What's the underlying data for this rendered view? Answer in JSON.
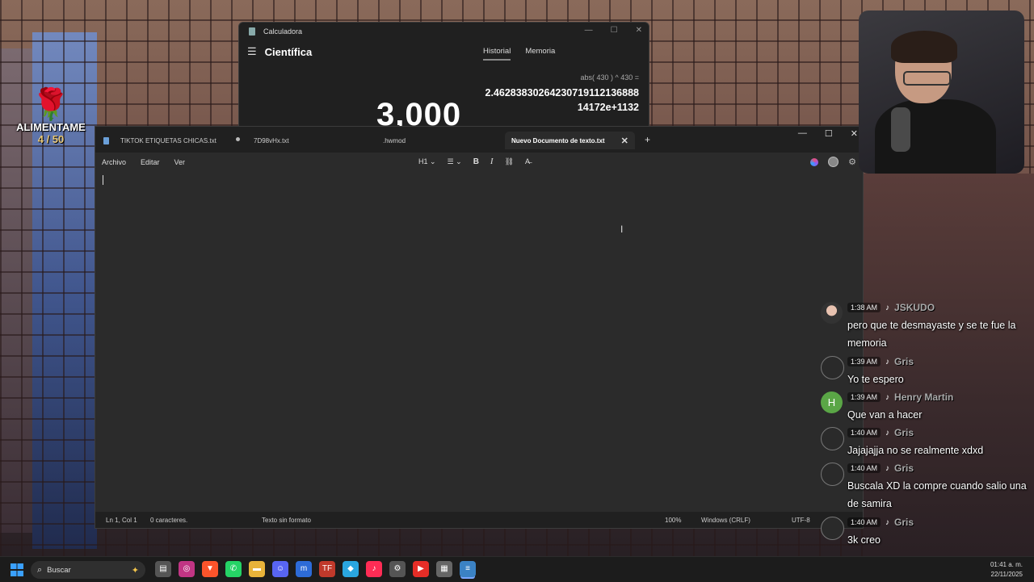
{
  "overlay": {
    "rose_glyph": "🌹",
    "title": "ALIMENTAME",
    "progress": "4 / 50"
  },
  "calculator": {
    "window_title": "Calculadora",
    "mode": "Científica",
    "tabs": [
      "Historial",
      "Memoria"
    ],
    "expression": "abs( 430 )   ^   430 =",
    "result_line1": "2.46283830264230719112136888",
    "result_line2": "14172e+1132",
    "display_value": "3,000",
    "window_buttons": [
      "—",
      "☐",
      "✕"
    ]
  },
  "notepad": {
    "tabs": [
      {
        "label": "TIKTOK ETIQUETAS CHICAS.txt",
        "modified": true
      },
      {
        "label": "7D98vHx.txt",
        "modified": false
      },
      {
        "label": ".hwmod",
        "modified": false
      },
      {
        "label": "Nuevo Documento de texto.txt",
        "active": true
      }
    ],
    "new_tab": "+",
    "close_tab": "✕",
    "window_buttons": [
      "—",
      "☐",
      "✕"
    ],
    "menu": [
      "Archivo",
      "Editar",
      "Ver"
    ],
    "format": {
      "heading": "H1",
      "list": "☰",
      "bold": "B",
      "italic": "I",
      "link": "⛓",
      "clear": "A̶"
    },
    "status": {
      "position": "Ln 1, Col 1",
      "chars": "0 caracteres.",
      "format": "Texto sin formato",
      "zoom": "100%",
      "line_ending": "Windows (CRLF)",
      "encoding": "UTF-8"
    }
  },
  "chat": [
    {
      "time": "1:38 AM",
      "user": "JSKUDO",
      "text": "pero que te desmayaste y se te fue la memoria",
      "avatar": "photo"
    },
    {
      "time": "1:39 AM",
      "user": "Gris",
      "text": "Yo te espero",
      "avatar": "dark"
    },
    {
      "time": "1:39 AM",
      "user": "Henry Martin",
      "text": "Que van a hacer",
      "avatar": "H"
    },
    {
      "time": "1:40 AM",
      "user": "Gris",
      "text": "Jajajajja no se realmente xdxd",
      "avatar": "dark"
    },
    {
      "time": "1:40 AM",
      "user": "Gris",
      "text": "Buscala XD la compre cuando salio una de samira",
      "avatar": "dark"
    },
    {
      "time": "1:40 AM",
      "user": "Gris",
      "text": "3k creo",
      "avatar": "dark"
    }
  ],
  "taskbar": {
    "search_placeholder": "Buscar",
    "apps": [
      {
        "name": "file-explorer-tile",
        "glyph": "▤",
        "color": "#555"
      },
      {
        "name": "instagram",
        "glyph": "◎",
        "color": "#c13584"
      },
      {
        "name": "brave",
        "glyph": "▼",
        "color": "#fb542b"
      },
      {
        "name": "whatsapp",
        "glyph": "✆",
        "color": "#25d366"
      },
      {
        "name": "folder",
        "glyph": "▬",
        "color": "#e8b33a"
      },
      {
        "name": "discord",
        "glyph": "☺",
        "color": "#5865f2"
      },
      {
        "name": "mobi",
        "glyph": "m",
        "color": "#2d6bd8"
      },
      {
        "name": "tf",
        "glyph": "TF",
        "color": "#c0392b"
      },
      {
        "name": "app-diamond",
        "glyph": "◆",
        "color": "#2aa6e0"
      },
      {
        "name": "tiktok",
        "glyph": "♪",
        "color": "#fe2c55"
      },
      {
        "name": "settings",
        "glyph": "⚙",
        "color": "#555"
      },
      {
        "name": "youtube-music",
        "glyph": "▶",
        "color": "#e52d27"
      },
      {
        "name": "calculator",
        "glyph": "▦",
        "color": "#666"
      },
      {
        "name": "notepad",
        "glyph": "≡",
        "color": "#3b82c4",
        "active": true
      }
    ],
    "time": "01:41 a. m.",
    "date": "22/11/2025"
  }
}
